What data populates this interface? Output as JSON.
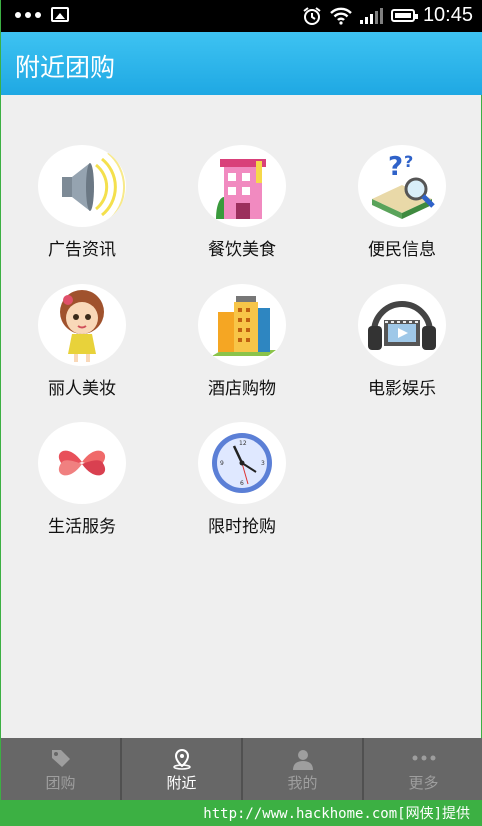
{
  "status_bar": {
    "time": "10:45",
    "icons": [
      "more-dots-icon",
      "image-icon",
      "alarm-icon",
      "wifi-icon",
      "signal-icon",
      "battery-icon"
    ]
  },
  "header": {
    "title": "附近团购"
  },
  "categories": [
    {
      "label": "广告资讯",
      "icon": "speaker-icon"
    },
    {
      "label": "餐饮美食",
      "icon": "restaurant-building-icon"
    },
    {
      "label": "便民信息",
      "icon": "book-magnifier-icon"
    },
    {
      "label": "丽人美妆",
      "icon": "girl-doll-icon"
    },
    {
      "label": "酒店购物",
      "icon": "hotel-building-icon"
    },
    {
      "label": "电影娱乐",
      "icon": "headphones-film-icon"
    },
    {
      "label": "生活服务",
      "icon": "hearts-flower-icon"
    },
    {
      "label": "限时抢购",
      "icon": "clock-icon"
    }
  ],
  "tabs": [
    {
      "label": "团购",
      "icon": "tag-icon",
      "active": false
    },
    {
      "label": "附近",
      "icon": "location-pin-icon",
      "active": true
    },
    {
      "label": "我的",
      "icon": "user-icon",
      "active": false
    },
    {
      "label": "更多",
      "icon": "more-dots-icon",
      "active": false
    }
  ],
  "watermark": "http://www.hackhome.com[网侠]提供",
  "colors": {
    "header": "#1fa8e3",
    "background": "#efefef",
    "tabbar": "#676767",
    "border": "#3cb043"
  }
}
